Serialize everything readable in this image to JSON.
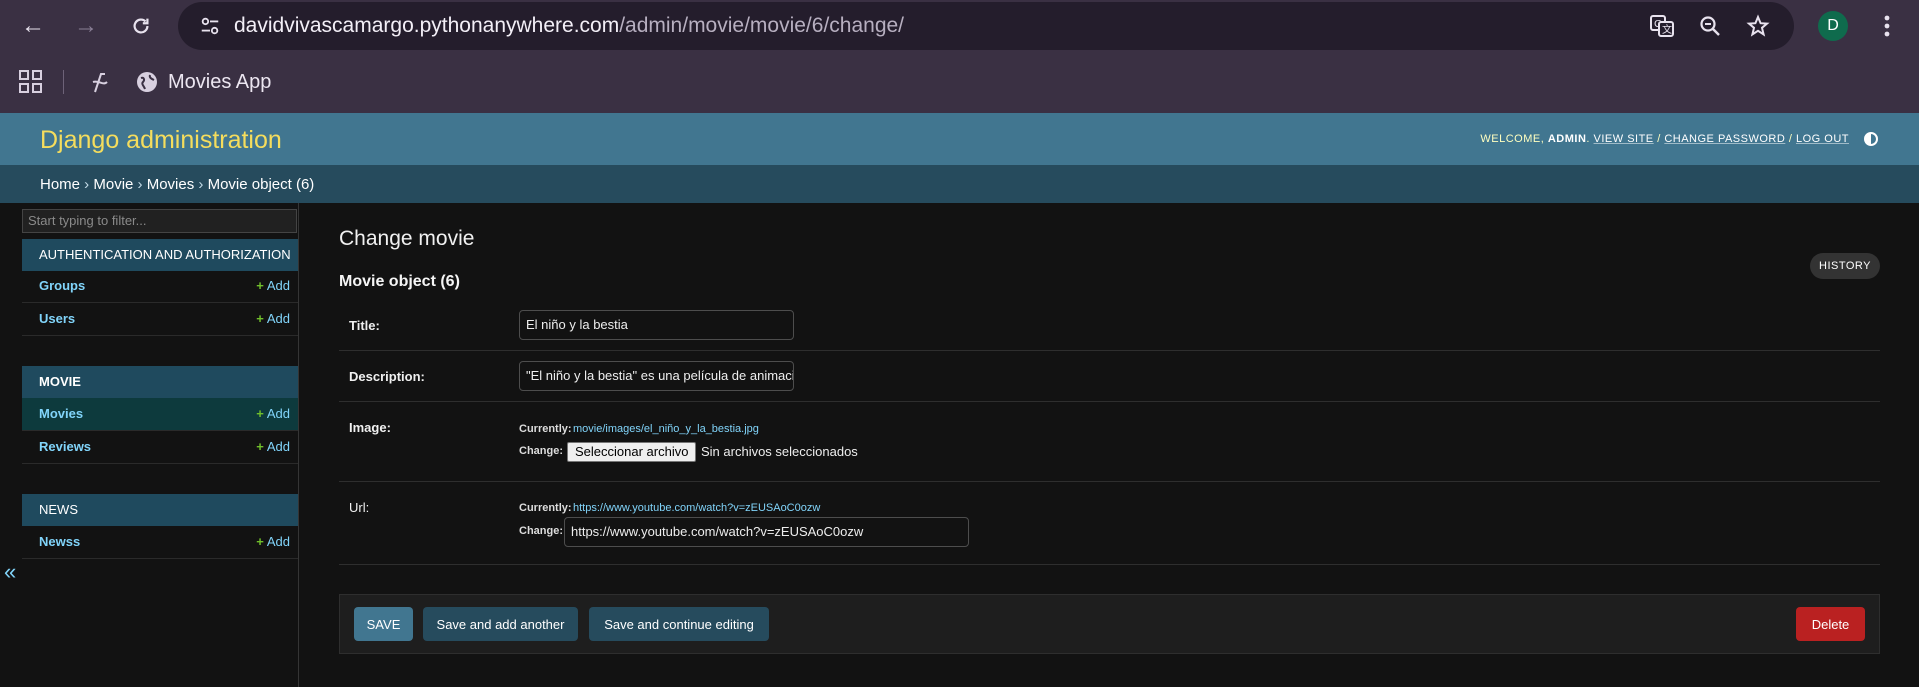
{
  "browser": {
    "url_host": "davidvivascamargo.pythonanywhere.com",
    "url_path": "/admin/movie/movie/6/change/",
    "profile_initial": "D",
    "bookmark_label": "Movies App",
    "icons": [
      "back-icon",
      "forward-icon",
      "reload-icon",
      "site-info-icon",
      "translate-icon",
      "zoom-icon",
      "star-icon",
      "menu-icon",
      "apps-icon",
      "globe-icon"
    ]
  },
  "header": {
    "brand": "Django administration",
    "welcome": "Welcome,",
    "username": "admin",
    "view_site": "View site",
    "change_password": "Change password",
    "log_out": "Log out"
  },
  "breadcrumbs": {
    "home": "Home",
    "app": "Movie",
    "model": "Movies",
    "current": "Movie object (6)"
  },
  "sidebar": {
    "filter_placeholder": "Start typing to filter...",
    "collapse_glyph": "«",
    "add_label": "Add",
    "apps": [
      {
        "caption": "Authentication and Authorization",
        "models": [
          "Groups",
          "Users"
        ]
      },
      {
        "caption": "Movie",
        "models": [
          "Movies",
          "Reviews"
        ]
      },
      {
        "caption": "News",
        "models": [
          "Newss"
        ]
      }
    ]
  },
  "content": {
    "page_title": "Change movie",
    "object_title": "Movie object (6)",
    "history_label": "History",
    "fields": {
      "title_label": "Title:",
      "title_value": "El niño y la bestia",
      "description_label": "Description:",
      "description_value": "\"El niño y la bestia\" es una película de animación",
      "image_label": "Image:",
      "image_currently_label": "Currently:",
      "image_current": "movie/images/el_niño_y_la_bestia.jpg",
      "image_change_label": "Change:",
      "file_button": "Seleccionar archivo",
      "file_status": "Sin archivos seleccionados",
      "url_label": "Url:",
      "url_currently_label": "Currently:",
      "url_current": "https://www.youtube.com/watch?v=zEUSAoC0ozw",
      "url_change_label": "Change:",
      "url_value": "https://www.youtube.com/watch?v=zEUSAoC0ozw"
    },
    "buttons": {
      "save": "Save",
      "save_add_another": "Save and add another",
      "save_continue": "Save and continue editing",
      "delete": "Delete"
    }
  }
}
